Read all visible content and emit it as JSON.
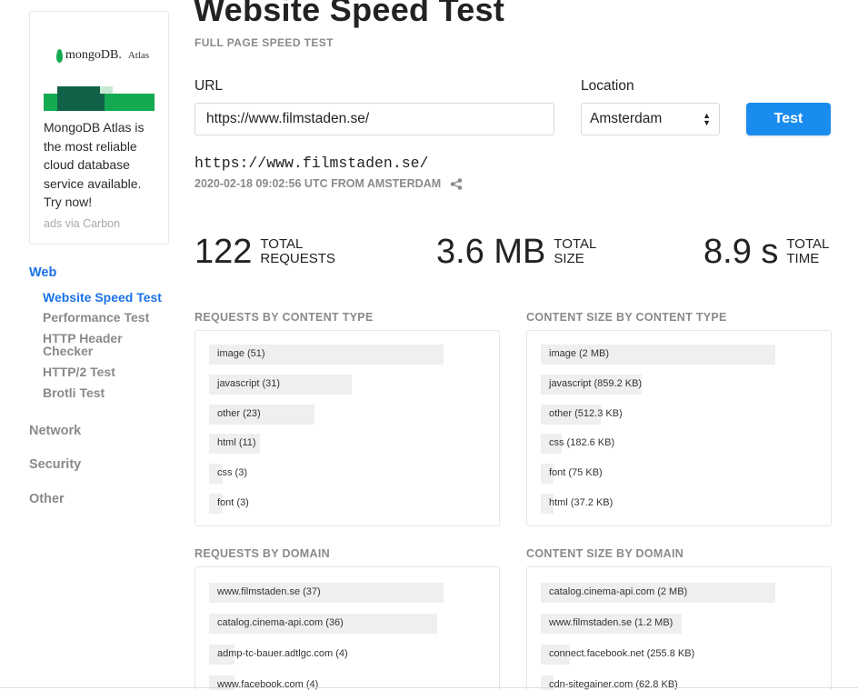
{
  "ad": {
    "brand": "mongoDB.",
    "brand_sub": "Atlas",
    "text": "MongoDB Atlas is the most reliable cloud database service available. Try now!",
    "via": "ads via Carbon"
  },
  "nav": {
    "sections": [
      {
        "label": "Web",
        "active": true,
        "items": [
          {
            "label": "Website Speed Test",
            "active": true
          },
          {
            "label": "Performance Test"
          },
          {
            "label": "HTTP Header Checker"
          },
          {
            "label": "HTTP/2 Test"
          },
          {
            "label": "Brotli Test"
          }
        ]
      },
      {
        "label": "Network"
      },
      {
        "label": "Security"
      },
      {
        "label": "Other"
      }
    ]
  },
  "page": {
    "title": "Website Speed Test",
    "subtitle": "FULL PAGE SPEED TEST"
  },
  "form": {
    "url_label": "URL",
    "url_value": "https://www.filmstaden.se/",
    "location_label": "Location",
    "location_value": "Amsterdam",
    "test_button": "Test"
  },
  "result": {
    "url": "https://www.filmstaden.se/",
    "meta": "2020-02-18 09:02:56 UTC FROM AMSTERDAM"
  },
  "stats": {
    "requests": {
      "value": "122",
      "label": "TOTAL REQUESTS"
    },
    "size": {
      "value": "3.6 MB",
      "label": "TOTAL SIZE"
    },
    "time": {
      "value": "8.9 s",
      "label": "TOTAL TIME"
    }
  },
  "panels": {
    "requests_by_type": {
      "title": "REQUESTS BY CONTENT TYPE",
      "rows": [
        {
          "label": "image (51)",
          "fraction": 1.0
        },
        {
          "label": "javascript (31)",
          "fraction": 0.608
        },
        {
          "label": "other (23)",
          "fraction": 0.451
        },
        {
          "label": "html (11)",
          "fraction": 0.216
        },
        {
          "label": "css (3)",
          "fraction": 0.06
        },
        {
          "label": "font (3)",
          "fraction": 0.06
        }
      ]
    },
    "size_by_type": {
      "title": "CONTENT SIZE BY CONTENT TYPE",
      "rows": [
        {
          "label": "image (2 MB)",
          "fraction": 1.0
        },
        {
          "label": "javascript (859.2 KB)",
          "fraction": 0.43
        },
        {
          "label": "other (512.3 KB)",
          "fraction": 0.256
        },
        {
          "label": "css (182.6 KB)",
          "fraction": 0.091
        },
        {
          "label": "font (75 KB)",
          "fraction": 0.037
        },
        {
          "label": "html (37.2 KB)",
          "fraction": 0.019
        }
      ]
    },
    "requests_by_domain": {
      "title": "REQUESTS BY DOMAIN",
      "rows": [
        {
          "label": "www.filmstaden.se (37)",
          "fraction": 1.0
        },
        {
          "label": "catalog.cinema-api.com (36)",
          "fraction": 0.973
        },
        {
          "label": "admp-tc-bauer.adtlgc.com (4)",
          "fraction": 0.108
        },
        {
          "label": "www.facebook.com (4)",
          "fraction": 0.108
        }
      ]
    },
    "size_by_domain": {
      "title": "CONTENT SIZE BY DOMAIN",
      "rows": [
        {
          "label": "catalog.cinema-api.com (2 MB)",
          "fraction": 1.0
        },
        {
          "label": "www.filmstaden.se (1.2 MB)",
          "fraction": 0.6
        },
        {
          "label": "connect.facebook.net (255.8 KB)",
          "fraction": 0.125
        },
        {
          "label": "cdn-sitegainer.com (62.8 KB)",
          "fraction": 0.031
        }
      ]
    }
  }
}
